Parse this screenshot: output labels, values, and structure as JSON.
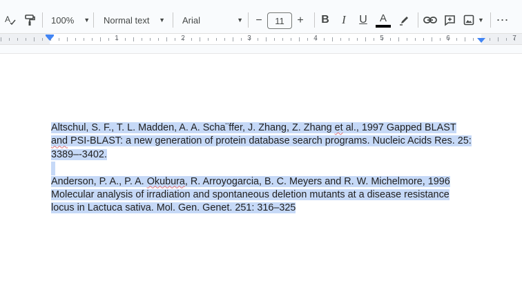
{
  "toolbar": {
    "zoom": "100%",
    "paragraph_style": "Normal text",
    "font": "Arial",
    "font_size": "11",
    "decrease_size": "−",
    "increase_size": "+",
    "bold": "B",
    "italic": "I",
    "underline": "U",
    "text_color": "A",
    "icons": [
      "spellcheck-icon",
      "paint-format-icon",
      "zoom-dropdown",
      "style-dropdown",
      "font-dropdown",
      "bold-icon",
      "italic-icon",
      "underline-icon",
      "text-color-icon",
      "highlight-icon",
      "link-icon",
      "comment-icon",
      "image-icon",
      "more-icon"
    ]
  },
  "ruler": {
    "numbers": [
      "1",
      "2",
      "3",
      "4",
      "5",
      "6",
      "7"
    ]
  },
  "document": {
    "ref1": {
      "line1_a": "Altschul, S. F., T. L. Madden, A. A. Scha¨ffer, J. Zhang, Z. Zhang ",
      "line1_b": "et",
      "line1_c": " al., 1997 Gapped BLAST",
      "line2_a": "and",
      "line2_b": " PSI-BLAST: a new generation of protein database search programs. Nucleic Acids Res. 25:",
      "line3": "3389–-3402."
    },
    "ref2": {
      "line1_a": "Anderson, P. A., P. A. ",
      "line1_b": "Okubura",
      "line1_c": ", R. Arroyogarcia, B. C. Meyers and R. W. Michelmore, 1996",
      "line2": "Molecular analysis of irradiation and spontaneous deletion mutants at a disease resistance",
      "line3": "locus in Lactuca sativa. Mol. Gen. Genet. 251: 316–325"
    }
  },
  "colors": {
    "selection": "#c6d9f7",
    "ruler_marker": "#4285f4",
    "spell_error": "#e0737a"
  }
}
